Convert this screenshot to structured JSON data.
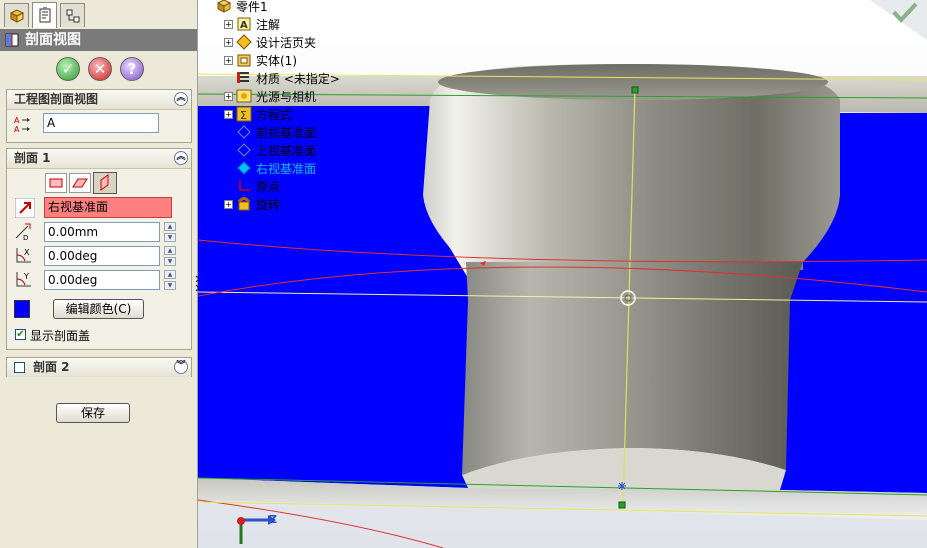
{
  "panel": {
    "title": "剖面视图",
    "buttons": {
      "ok": "✓",
      "cancel": "✕",
      "help": "?"
    },
    "drawing_group": {
      "title": "工程图剖面视图",
      "name_value": "A"
    },
    "section1": {
      "title": "剖面 1",
      "plane_value": "右视基准面",
      "offset_value": "0.00mm",
      "x_rotation_value": "0.00deg",
      "y_rotation_value": "0.00deg",
      "edit_color_label": "编辑颜色(C)",
      "show_cap_label": "显示剖面盖",
      "show_cap_checked": true,
      "section_color": "#0000ff"
    },
    "section2": {
      "title": "剖面 2",
      "checked": false
    },
    "save_label": "保存"
  },
  "tree": {
    "root": "零件1",
    "items": [
      {
        "label": "注解",
        "icon": "annotation-icon",
        "expandable": true
      },
      {
        "label": "设计活页夹",
        "icon": "design-binder-icon",
        "expandable": true
      },
      {
        "label": "实体(1)",
        "icon": "solid-bodies-icon",
        "expandable": true
      },
      {
        "label": "材质 <未指定>",
        "icon": "material-icon",
        "expandable": false
      },
      {
        "label": "光源与相机",
        "icon": "lights-cameras-icon",
        "expandable": true
      },
      {
        "label": "方程式",
        "icon": "equations-icon",
        "expandable": true
      },
      {
        "label": "前视基准面",
        "icon": "plane-icon",
        "expandable": false
      },
      {
        "label": "上视基准面",
        "icon": "plane-icon",
        "expandable": false
      },
      {
        "label": "右视基准面",
        "icon": "plane-icon",
        "expandable": false,
        "selected": true
      },
      {
        "label": "原点",
        "icon": "origin-icon",
        "expandable": false
      },
      {
        "label": "旋转",
        "icon": "revolve-icon",
        "expandable": true
      }
    ]
  },
  "triad": {
    "z_label": "Z"
  },
  "colors": {
    "section_cap": "#0000ff",
    "selected_text": "#00c0ff",
    "panel_bg": "#ece9d8"
  }
}
